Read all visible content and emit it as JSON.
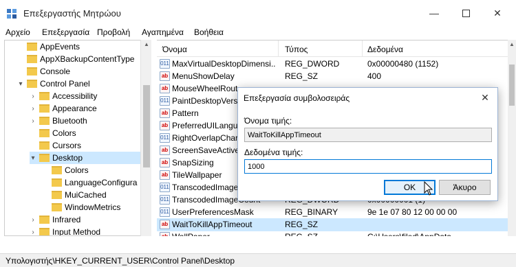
{
  "window": {
    "title": "Επεξεργαστής Μητρώου"
  },
  "menu": [
    "Αρχείο",
    "Επεξεργασία",
    "Προβολή",
    "Αγαπημένα",
    "Βοήθεια"
  ],
  "tree": {
    "items": [
      {
        "label": "AppEvents",
        "level": 0,
        "arrow": ""
      },
      {
        "label": "AppXBackupContentType",
        "level": 0,
        "arrow": ""
      },
      {
        "label": "Console",
        "level": 0,
        "arrow": ""
      },
      {
        "label": "Control Panel",
        "level": 0,
        "arrow": "▾"
      },
      {
        "label": "Accessibility",
        "level": 1,
        "arrow": "›"
      },
      {
        "label": "Appearance",
        "level": 1,
        "arrow": "›"
      },
      {
        "label": "Bluetooth",
        "level": 1,
        "arrow": "›"
      },
      {
        "label": "Colors",
        "level": 1,
        "arrow": ""
      },
      {
        "label": "Cursors",
        "level": 1,
        "arrow": ""
      },
      {
        "label": "Desktop",
        "level": 1,
        "arrow": "▾"
      },
      {
        "label": "Colors",
        "level": 2,
        "arrow": ""
      },
      {
        "label": "LanguageConfigura",
        "level": 2,
        "arrow": ""
      },
      {
        "label": "MuiCached",
        "level": 2,
        "arrow": ""
      },
      {
        "label": "WindowMetrics",
        "level": 2,
        "arrow": ""
      },
      {
        "label": "Infrared",
        "level": 1,
        "arrow": "›"
      },
      {
        "label": "Input Method",
        "level": 1,
        "arrow": "›"
      }
    ]
  },
  "list": {
    "headers": {
      "name": "Όνομα",
      "type": "Τύπος",
      "data": "Δεδομένα"
    },
    "rows": [
      {
        "icon": "bin",
        "name": "MaxVirtualDesktopDimensi...",
        "type": "REG_DWORD",
        "data": "0x00000480 (1152)"
      },
      {
        "icon": "sz",
        "name": "MenuShowDelay",
        "type": "REG_SZ",
        "data": "400"
      },
      {
        "icon": "sz",
        "name": "MouseWheelRout",
        "type": "",
        "data": ""
      },
      {
        "icon": "bin",
        "name": "PaintDesktopVersi",
        "type": "",
        "data": ""
      },
      {
        "icon": "sz",
        "name": "Pattern",
        "type": "",
        "data": ""
      },
      {
        "icon": "sz",
        "name": "PreferredUILangua",
        "type": "",
        "data": ""
      },
      {
        "icon": "bin",
        "name": "RightOverlapChar",
        "type": "",
        "data": ""
      },
      {
        "icon": "sz",
        "name": "ScreenSaveActive",
        "type": "",
        "data": ""
      },
      {
        "icon": "sz",
        "name": "SnapSizing",
        "type": "",
        "data": ""
      },
      {
        "icon": "sz",
        "name": "TileWallpaper",
        "type": "",
        "data": ""
      },
      {
        "icon": "bin",
        "name": "TranscodedImage",
        "type": "",
        "data": ""
      },
      {
        "icon": "bin",
        "name": "TranscodedImageCount",
        "type": "REG_DWORD",
        "data": "0x00000001 (1)"
      },
      {
        "icon": "bin",
        "name": "UserPreferencesMask",
        "type": "REG_BINARY",
        "data": "9e 1e 07 80 12 00 00 00"
      },
      {
        "icon": "sz",
        "name": "WaitToKillAppTimeout",
        "type": "REG_SZ",
        "data": ""
      },
      {
        "icon": "sz",
        "name": "WallPaper",
        "type": "REG_SZ",
        "data": "C:\\Users\\filed\\AppData"
      }
    ]
  },
  "status": {
    "path": "Υπολογιστής\\HKEY_CURRENT_USER\\Control Panel\\Desktop"
  },
  "dialog": {
    "title": "Επεξεργασία συμβολοσειράς",
    "value_name_label": "Όνομα τιμής:",
    "value_name": "WaitToKillAppTimeout",
    "value_data_label": "Δεδομένα τιμής:",
    "value_data": "1000",
    "ok_label": "OK",
    "cancel_label": "Άκυρο"
  }
}
